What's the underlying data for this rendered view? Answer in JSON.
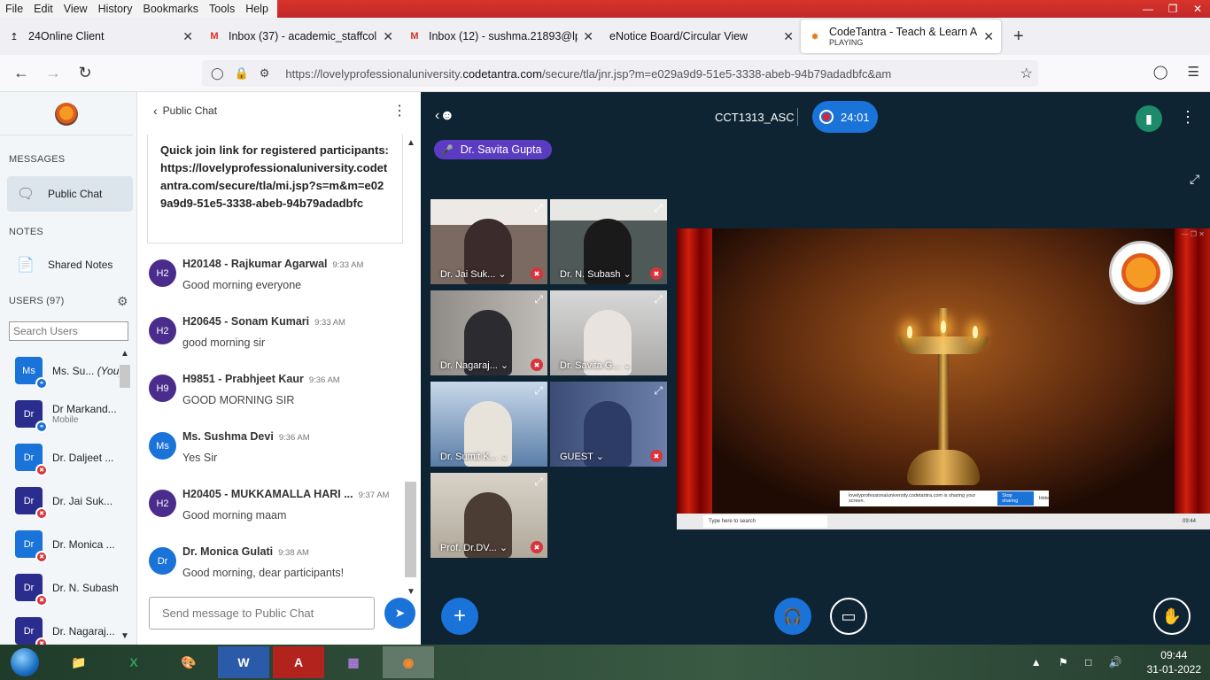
{
  "menubar": {
    "items": [
      "File",
      "Edit",
      "View",
      "History",
      "Bookmarks",
      "Tools",
      "Help"
    ]
  },
  "tabs": [
    {
      "title": "24Online Client",
      "icon": "arrow-icon"
    },
    {
      "title": "Inbox (37) - academic_staffcolle",
      "icon": "gmail-icon"
    },
    {
      "title": "Inbox (12) - sushma.21893@lpu",
      "icon": "gmail-icon"
    },
    {
      "title": "eNotice Board/Circular View",
      "icon": ""
    },
    {
      "title": "CodeTantra - Teach & Learn An",
      "subtitle": "PLAYING",
      "icon": "codetantra-icon",
      "active": true
    }
  ],
  "url": {
    "prefix": "https://lovelyprofessionaluniversity.",
    "domain": "codetantra.com",
    "path": "/secure/tla/jnr.jsp?m=e029a9d9-51e5-3338-abeb-94b79adadbfc&am"
  },
  "sidebar": {
    "messages_heading": "MESSAGES",
    "public_chat": "Public Chat",
    "notes_heading": "NOTES",
    "shared_notes": "Shared Notes",
    "users_heading": "USERS (97)",
    "search_placeholder": "Search Users",
    "users": [
      {
        "initials": "Ms",
        "name": "Ms. Su...",
        "you": "(You)",
        "color": "#1a73d9",
        "status": "headset"
      },
      {
        "initials": "Dr",
        "name": "Dr Markand...",
        "sub": "Mobile",
        "color": "#2b2d8e",
        "status": "headset"
      },
      {
        "initials": "Dr",
        "name": "Dr. Daljeet ...",
        "color": "#1a73d9",
        "status": "muted"
      },
      {
        "initials": "Dr",
        "name": "Dr. Jai Suk...",
        "color": "#2b2d8e",
        "status": "muted"
      },
      {
        "initials": "Dr",
        "name": "Dr. Monica ...",
        "color": "#1a73d9",
        "status": "muted"
      },
      {
        "initials": "Dr",
        "name": "Dr. N. Subash",
        "color": "#2b2d8e",
        "status": "muted"
      },
      {
        "initials": "Dr",
        "name": "Dr. Nagaraj...",
        "color": "#2b2d8e",
        "status": "muted"
      }
    ]
  },
  "chat": {
    "title": "Public Chat",
    "pinned": "Quick join link for registered participants: https://lovelyprofessionaluniversity.codetantra.com/secure/tla/mi.jsp?s=m&m=e029a9d9-51e5-3338-abeb-94b79adadbfc",
    "messages": [
      {
        "initials": "H2",
        "name": "H20148 - Rajkumar Agarwal",
        "time": "9:33 AM",
        "text": "Good morning everyone",
        "color": "#4a2c8c"
      },
      {
        "initials": "H2",
        "name": "H20645 - Sonam Kumari",
        "time": "9:33 AM",
        "text": "good morning sir",
        "color": "#4a2c8c"
      },
      {
        "initials": "H9",
        "name": "H9851 - Prabhjeet Kaur",
        "time": "9:36 AM",
        "text": "GOOD MORNING SIR",
        "color": "#4a2c8c"
      },
      {
        "initials": "Ms",
        "name": "Ms. Sushma Devi",
        "time": "9:36 AM",
        "text": "Yes Sir",
        "color": "#1a73d9"
      },
      {
        "initials": "H2",
        "name": "H20405 - MUKKAMALLA HARI ...",
        "time": "9:37 AM",
        "text": "Good morning maam",
        "color": "#4a2c8c"
      },
      {
        "initials": "Dr",
        "name": "Dr. Monica Gulati",
        "time": "9:38 AM",
        "text": "Good morning, dear participants!",
        "color": "#1a73d9"
      }
    ],
    "input_placeholder": "Send message to Public Chat"
  },
  "stage": {
    "meeting_name": "CCT1313_ASC",
    "timer": "24:01",
    "talker": "Dr. Savita Gupta",
    "videos": [
      {
        "label": "Dr. Jai Suk...",
        "muted": true,
        "bg": "#7a6a62",
        "person": "#3b2b2b"
      },
      {
        "label": "Dr. N. Subash",
        "muted": true,
        "bg": "#4f5a58",
        "person": "#1a1a1a"
      },
      {
        "label": "Dr. Nagaraj...",
        "muted": true,
        "bg": "#8e8a86",
        "person": "#2b2b30"
      },
      {
        "label": "Dr. Savita G...",
        "muted": false,
        "active": true,
        "bg": "#a9a8a6",
        "person": "#e9e3e0"
      },
      {
        "label": "Dr. Sumit K...",
        "muted": false,
        "bg": "#5a7ea8",
        "person": "#e7e3da"
      },
      {
        "label": "GUEST",
        "muted": true,
        "bg": "#3b4d77",
        "person": "#2d3c66"
      },
      {
        "label": "Prof. Dr.DV...",
        "muted": true,
        "bg": "#b0a89a",
        "person": "#4b3d33"
      }
    ],
    "share_bar": {
      "text": "lovelyprofessionaluniversity.codetantra.com is sharing your screen.",
      "stop": "Stop sharing",
      "hide": "Hide"
    },
    "mini_taskbar_search": "Type here to search",
    "mini_clock": "09:44"
  },
  "taskbar": {
    "apps": [
      "explorer",
      "excel",
      "paint",
      "word",
      "acrobat",
      "winrar",
      "firefox"
    ],
    "time": "09:44",
    "date": "31-01-2022"
  }
}
